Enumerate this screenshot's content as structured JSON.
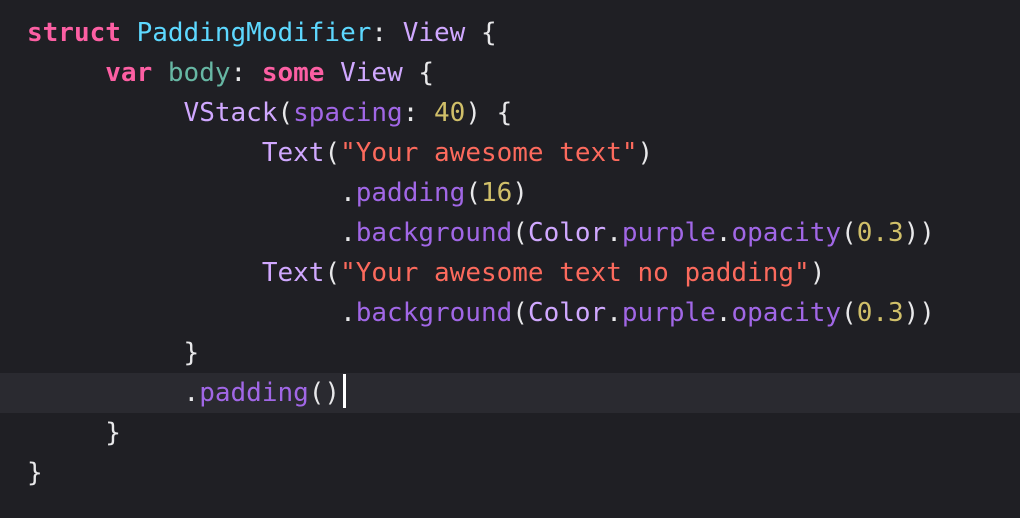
{
  "editor": {
    "colors": {
      "background": "#1f1f24",
      "current_line": "#2a2a30",
      "keyword": "#fc5fa3",
      "type_decl": "#5dd8ff",
      "type": "#d0a8ff",
      "project_member": "#a167e6",
      "property": "#67b7a4",
      "string": "#fc6a5d",
      "number": "#d0bf69",
      "plain": "#e8e8ea"
    },
    "lines": [
      [
        {
          "t": "struct",
          "c": "keyword",
          "b": true
        },
        {
          "t": " ",
          "c": "plain"
        },
        {
          "t": "PaddingModifier",
          "c": "type_decl"
        },
        {
          "t": ": ",
          "c": "plain"
        },
        {
          "t": "View",
          "c": "type"
        },
        {
          "t": " {",
          "c": "plain"
        }
      ],
      [
        {
          "t": "     ",
          "c": "plain"
        },
        {
          "t": "var",
          "c": "keyword",
          "b": true
        },
        {
          "t": " ",
          "c": "plain"
        },
        {
          "t": "body",
          "c": "property"
        },
        {
          "t": ": ",
          "c": "plain"
        },
        {
          "t": "some",
          "c": "keyword",
          "b": true
        },
        {
          "t": " ",
          "c": "plain"
        },
        {
          "t": "View",
          "c": "type"
        },
        {
          "t": " {",
          "c": "plain"
        }
      ],
      [
        {
          "t": "          ",
          "c": "plain"
        },
        {
          "t": "VStack",
          "c": "type"
        },
        {
          "t": "(",
          "c": "plain"
        },
        {
          "t": "spacing",
          "c": "project_member"
        },
        {
          "t": ": ",
          "c": "plain"
        },
        {
          "t": "40",
          "c": "number"
        },
        {
          "t": ") {",
          "c": "plain"
        }
      ],
      [
        {
          "t": "               ",
          "c": "plain"
        },
        {
          "t": "Text",
          "c": "type"
        },
        {
          "t": "(",
          "c": "plain"
        },
        {
          "t": "\"Your awesome text\"",
          "c": "string"
        },
        {
          "t": ")",
          "c": "plain"
        }
      ],
      [
        {
          "t": "                    ",
          "c": "plain"
        },
        {
          "t": ".",
          "c": "plain"
        },
        {
          "t": "padding",
          "c": "project_member"
        },
        {
          "t": "(",
          "c": "plain"
        },
        {
          "t": "16",
          "c": "number"
        },
        {
          "t": ")",
          "c": "plain"
        }
      ],
      [
        {
          "t": "                    ",
          "c": "plain"
        },
        {
          "t": ".",
          "c": "plain"
        },
        {
          "t": "background",
          "c": "project_member"
        },
        {
          "t": "(",
          "c": "plain"
        },
        {
          "t": "Color",
          "c": "type"
        },
        {
          "t": ".",
          "c": "plain"
        },
        {
          "t": "purple",
          "c": "project_member"
        },
        {
          "t": ".",
          "c": "plain"
        },
        {
          "t": "opacity",
          "c": "project_member"
        },
        {
          "t": "(",
          "c": "plain"
        },
        {
          "t": "0.3",
          "c": "number"
        },
        {
          "t": "))",
          "c": "plain"
        }
      ],
      [
        {
          "t": "               ",
          "c": "plain"
        },
        {
          "t": "Text",
          "c": "type"
        },
        {
          "t": "(",
          "c": "plain"
        },
        {
          "t": "\"Your awesome text no padding\"",
          "c": "string"
        },
        {
          "t": ")",
          "c": "plain"
        }
      ],
      [
        {
          "t": "                    ",
          "c": "plain"
        },
        {
          "t": ".",
          "c": "plain"
        },
        {
          "t": "background",
          "c": "project_member"
        },
        {
          "t": "(",
          "c": "plain"
        },
        {
          "t": "Color",
          "c": "type"
        },
        {
          "t": ".",
          "c": "plain"
        },
        {
          "t": "purple",
          "c": "project_member"
        },
        {
          "t": ".",
          "c": "plain"
        },
        {
          "t": "opacity",
          "c": "project_member"
        },
        {
          "t": "(",
          "c": "plain"
        },
        {
          "t": "0.3",
          "c": "number"
        },
        {
          "t": "))",
          "c": "plain"
        }
      ],
      [
        {
          "t": "          ",
          "c": "plain"
        },
        {
          "t": "}",
          "c": "plain"
        }
      ],
      [
        {
          "t": "          ",
          "c": "plain"
        },
        {
          "t": ".",
          "c": "plain"
        },
        {
          "t": "padding",
          "c": "project_member"
        },
        {
          "t": "()",
          "c": "plain"
        }
      ],
      [
        {
          "t": "     ",
          "c": "plain"
        },
        {
          "t": "}",
          "c": "plain"
        }
      ],
      [
        {
          "t": "}",
          "c": "plain"
        }
      ]
    ],
    "current_line_index": 9
  }
}
